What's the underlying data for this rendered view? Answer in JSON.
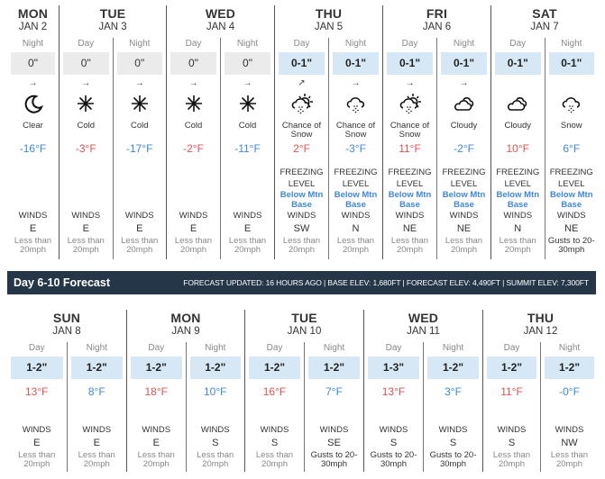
{
  "top_days": [
    {
      "name": "MON",
      "date": "JAN 2",
      "periods": [
        {
          "label": "Night",
          "snow": "0\"",
          "snow_style": "gray",
          "arrow": "→",
          "icon": "moon-icon",
          "cond": "Clear",
          "temp": "-16°F",
          "temp_style": "cold",
          "freezing": null,
          "winds_label": "WINDS",
          "wind_dir": "E",
          "wind_speed": "Less than 20mph",
          "gust": false
        }
      ]
    },
    {
      "name": "TUE",
      "date": "JAN 3",
      "periods": [
        {
          "label": "Day",
          "snow": "0\"",
          "snow_style": "gray",
          "arrow": "→",
          "icon": "cold-icon",
          "cond": "Cold",
          "temp": "-3°F",
          "temp_style": "warm",
          "freezing": null,
          "winds_label": "WINDS",
          "wind_dir": "E",
          "wind_speed": "Less than 20mph",
          "gust": false
        },
        {
          "label": "Night",
          "snow": "0\"",
          "snow_style": "gray",
          "arrow": "→",
          "icon": "cold-icon",
          "cond": "Cold",
          "temp": "-17°F",
          "temp_style": "cold",
          "freezing": null,
          "winds_label": "WINDS",
          "wind_dir": "E",
          "wind_speed": "Less than 20mph",
          "gust": false
        }
      ]
    },
    {
      "name": "WED",
      "date": "JAN 4",
      "periods": [
        {
          "label": "Day",
          "snow": "0\"",
          "snow_style": "gray",
          "arrow": "→",
          "icon": "cold-icon",
          "cond": "Cold",
          "temp": "-2°F",
          "temp_style": "warm",
          "freezing": null,
          "winds_label": "WINDS",
          "wind_dir": "E",
          "wind_speed": "Less than 20mph",
          "gust": false
        },
        {
          "label": "Night",
          "snow": "0\"",
          "snow_style": "gray",
          "arrow": "→",
          "icon": "cold-icon",
          "cond": "Cold",
          "temp": "-11°F",
          "temp_style": "cold",
          "freezing": null,
          "winds_label": "WINDS",
          "wind_dir": "E",
          "wind_speed": "Less than 20mph",
          "gust": false
        }
      ]
    },
    {
      "name": "THU",
      "date": "JAN 5",
      "periods": [
        {
          "label": "Day",
          "snow": "0-1\"",
          "snow_style": "blue",
          "arrow": "↗",
          "icon": "sun-cloud-snow-icon",
          "cond": "Chance of Snow",
          "temp": "2°F",
          "temp_style": "warm",
          "freezing": {
            "label": "FREEZING LEVEL",
            "value": "Below Mtn Base"
          },
          "winds_label": "WINDS",
          "wind_dir": "SW",
          "wind_speed": "Less than 20mph",
          "gust": false
        },
        {
          "label": "Night",
          "snow": "0-1\"",
          "snow_style": "blue",
          "arrow": "→",
          "icon": "cloud-snow-icon",
          "cond": "Chance of Snow",
          "temp": "-3°F",
          "temp_style": "cold",
          "freezing": {
            "label": "FREEZING LEVEL",
            "value": "Below Mtn Base"
          },
          "winds_label": "WINDS",
          "wind_dir": "N",
          "wind_speed": "Less than 20mph",
          "gust": false
        }
      ]
    },
    {
      "name": "FRI",
      "date": "JAN 6",
      "periods": [
        {
          "label": "Day",
          "snow": "0-1\"",
          "snow_style": "blue",
          "arrow": "→",
          "icon": "sun-cloud-snow-icon",
          "cond": "Chance of Snow",
          "temp": "11°F",
          "temp_style": "warm",
          "freezing": {
            "label": "FREEZING LEVEL",
            "value": "Below Mtn Base"
          },
          "winds_label": "WINDS",
          "wind_dir": "NE",
          "wind_speed": "Less than 20mph",
          "gust": false
        },
        {
          "label": "Night",
          "snow": "0-1\"",
          "snow_style": "blue",
          "arrow": "→",
          "icon": "cloudy-icon",
          "cond": "Cloudy",
          "temp": "-2°F",
          "temp_style": "cold",
          "freezing": {
            "label": "FREEZING LEVEL",
            "value": "Below Mtn Base"
          },
          "winds_label": "WINDS",
          "wind_dir": "NE",
          "wind_speed": "Less than 20mph",
          "gust": false
        }
      ]
    },
    {
      "name": "SAT",
      "date": "JAN 7",
      "periods": [
        {
          "label": "Day",
          "snow": "0-1\"",
          "snow_style": "blue",
          "arrow": "",
          "icon": "cloudy-icon",
          "cond": "Cloudy",
          "temp": "10°F",
          "temp_style": "warm",
          "freezing": {
            "label": "FREEZING LEVEL",
            "value": "Below Mtn Base"
          },
          "winds_label": "WINDS",
          "wind_dir": "N",
          "wind_speed": "Less than 20mph",
          "gust": false
        },
        {
          "label": "Night",
          "snow": "0-1\"",
          "snow_style": "blue",
          "arrow": "",
          "icon": "cloud-snow-icon",
          "cond": "Snow",
          "temp": "6°F",
          "temp_style": "cold",
          "freezing": {
            "label": "FREEZING LEVEL",
            "value": "Below Mtn Base"
          },
          "winds_label": "WINDS",
          "wind_dir": "NE",
          "wind_speed": "Gusts to 20-30mph",
          "gust": true
        }
      ]
    }
  ],
  "banner": {
    "title": "Day 6-10 Forecast",
    "info": "FORECAST UPDATED: 16 HOURS AGO | BASE ELEV: 1,680FT | FORECAST ELEV: 4,490FT | SUMMIT ELEV: 7,300FT"
  },
  "bottom_days": [
    {
      "name": "SUN",
      "date": "JAN 8",
      "periods": [
        {
          "label": "Day",
          "snow": "1-2\"",
          "temp": "13°F",
          "temp_style": "warm",
          "winds_label": "WINDS",
          "wind_dir": "E",
          "wind_speed": "Less than 20mph",
          "gust": false
        },
        {
          "label": "Night",
          "snow": "1-2\"",
          "temp": "8°F",
          "temp_style": "cold",
          "winds_label": "WINDS",
          "wind_dir": "E",
          "wind_speed": "Less than 20mph",
          "gust": false
        }
      ]
    },
    {
      "name": "MON",
      "date": "JAN 9",
      "periods": [
        {
          "label": "Day",
          "snow": "1-2\"",
          "temp": "18°F",
          "temp_style": "warm",
          "winds_label": "WINDS",
          "wind_dir": "E",
          "wind_speed": "Less than 20mph",
          "gust": false
        },
        {
          "label": "Night",
          "snow": "1-2\"",
          "temp": "10°F",
          "temp_style": "cold",
          "winds_label": "WINDS",
          "wind_dir": "S",
          "wind_speed": "Less than 20mph",
          "gust": false
        }
      ]
    },
    {
      "name": "TUE",
      "date": "JAN 10",
      "periods": [
        {
          "label": "Day",
          "snow": "1-2\"",
          "temp": "16°F",
          "temp_style": "warm",
          "winds_label": "WINDS",
          "wind_dir": "S",
          "wind_speed": "Less than 20mph",
          "gust": false
        },
        {
          "label": "Night",
          "snow": "1-2\"",
          "temp": "7°F",
          "temp_style": "cold",
          "winds_label": "WINDS",
          "wind_dir": "SE",
          "wind_speed": "Gusts to 20-30mph",
          "gust": true
        }
      ]
    },
    {
      "name": "WED",
      "date": "JAN 11",
      "periods": [
        {
          "label": "Day",
          "snow": "1-3\"",
          "temp": "13°F",
          "temp_style": "warm",
          "winds_label": "WINDS",
          "wind_dir": "S",
          "wind_speed": "Gusts to 20-30mph",
          "gust": true
        },
        {
          "label": "Night",
          "snow": "1-2\"",
          "temp": "3°F",
          "temp_style": "cold",
          "winds_label": "WINDS",
          "wind_dir": "S",
          "wind_speed": "Gusts to 20-30mph",
          "gust": true
        }
      ]
    },
    {
      "name": "THU",
      "date": "JAN 12",
      "periods": [
        {
          "label": "Day",
          "snow": "1-2\"",
          "temp": "11°F",
          "temp_style": "warm",
          "winds_label": "WINDS",
          "wind_dir": "S",
          "wind_speed": "Less than 20mph",
          "gust": false
        },
        {
          "label": "Night",
          "snow": "1-2\"",
          "temp": "-0°F",
          "temp_style": "cold",
          "winds_label": "WINDS",
          "wind_dir": "NW",
          "wind_speed": "Less than 20mph",
          "gust": false
        }
      ]
    }
  ]
}
